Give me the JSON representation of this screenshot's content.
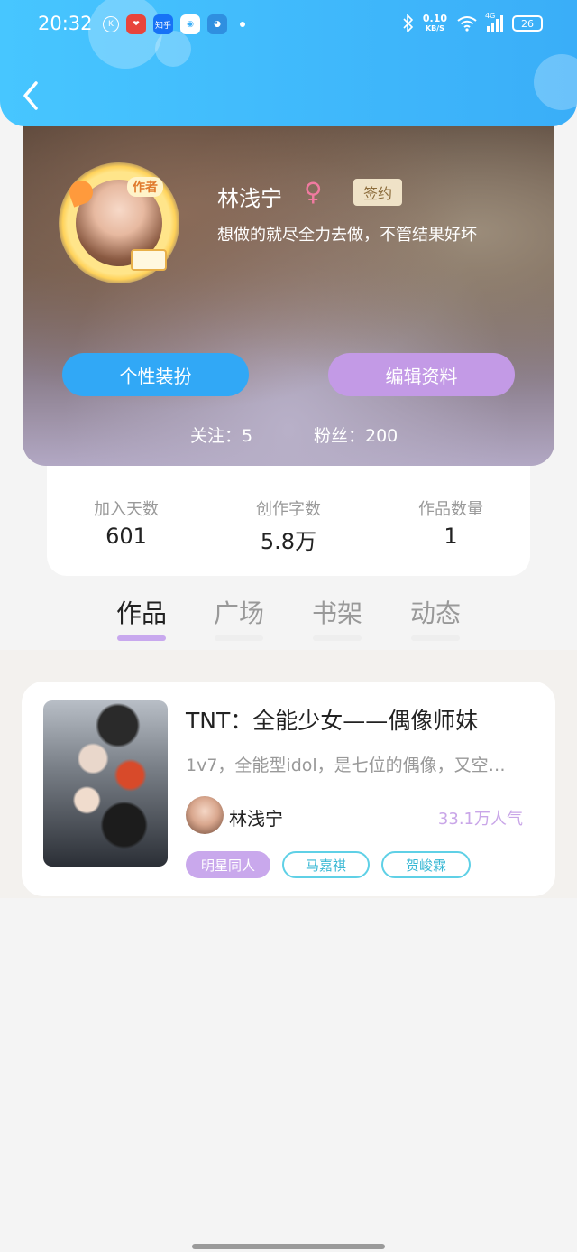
{
  "status_bar": {
    "time": "20:32",
    "net_speed_value": "0.10",
    "net_speed_unit": "KB/S",
    "battery": "26",
    "signal": "4G",
    "app_icons": [
      "K",
      "❤",
      "知乎",
      "◉",
      "◕"
    ]
  },
  "profile": {
    "avatar_badge": "作者",
    "name": "林浅宁",
    "gender_symbol": "♀",
    "sign_badge": "签约",
    "motto": "想做的就尽全力去做，不管结果好坏",
    "dress_button": "个性装扮",
    "edit_button": "编辑资料",
    "follow_label": "关注：5",
    "fans_label": "粉丝：200"
  },
  "stats": [
    {
      "label": "加入天数",
      "value": "601"
    },
    {
      "label": "创作字数",
      "value": "5.8万"
    },
    {
      "label": "作品数量",
      "value": "1"
    }
  ],
  "tabs": [
    {
      "label": "作品",
      "active": true
    },
    {
      "label": "广场",
      "active": false
    },
    {
      "label": "书架",
      "active": false
    },
    {
      "label": "动态",
      "active": false
    }
  ],
  "work": {
    "title": "TNT：全能少女——偶像师妹",
    "description": "1v7，全能型idol，是七位的偶像，又空…",
    "author": "林浅宁",
    "popularity": "33.1万人气",
    "tags": [
      "明星同人",
      "马嘉祺",
      "贺峻霖"
    ]
  },
  "colors": {
    "header": "#3aaef8",
    "accent_purple": "#c39ae6",
    "accent_blue": "#31a8f6",
    "tag_cyan": "#5fd0e6"
  }
}
